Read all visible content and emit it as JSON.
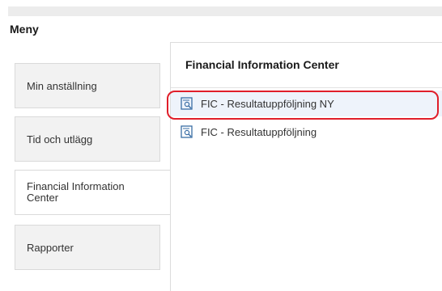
{
  "sidebar": {
    "title": "Meny",
    "items": [
      {
        "label": "Min anställning"
      },
      {
        "label": "Tid och utlägg"
      },
      {
        "label": "Financial Information Center"
      },
      {
        "label": "Rapporter"
      }
    ]
  },
  "panel": {
    "title": "Financial Information Center",
    "items": [
      {
        "label": "FIC - Resultatuppföljning NY",
        "icon": "report-search-icon"
      },
      {
        "label": "FIC - Resultatuppföljning",
        "icon": "report-search-icon"
      }
    ]
  },
  "colors": {
    "accent": "#3a6ea5",
    "highlight_ring": "#e01e2a"
  }
}
